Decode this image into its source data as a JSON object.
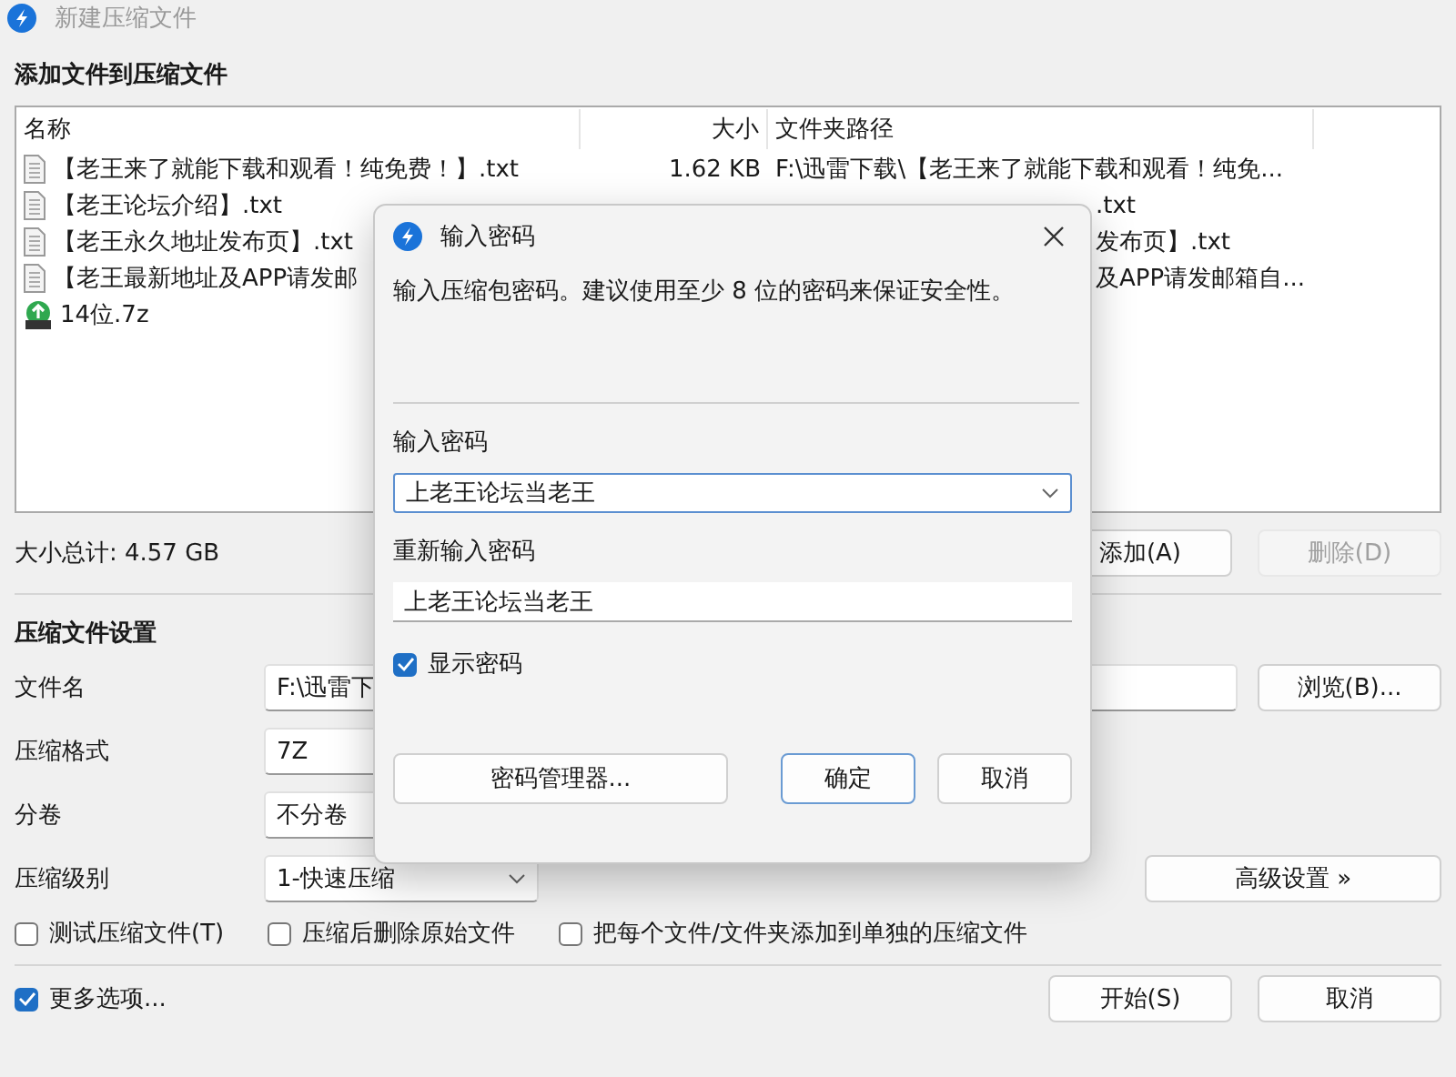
{
  "window": {
    "title": "新建压缩文件"
  },
  "files": {
    "heading": "添加文件到压缩文件",
    "columns": [
      "名称",
      "大小",
      "文件夹路径"
    ],
    "rows": [
      {
        "kind": "text",
        "name": "【老王来了就能下载和观看！纯免费！】.txt",
        "size": "1.62 KB",
        "path": "F:\\迅雷下载\\【老王来了就能下载和观看！纯免...",
        "covered": false
      },
      {
        "kind": "text",
        "name": "【老王论坛介绍】.txt",
        "path": ".txt",
        "covered": true
      },
      {
        "kind": "text",
        "name": "【老王永久地址发布页】.txt",
        "path": "发布页】.txt",
        "covered": true
      },
      {
        "kind": "text",
        "name": "【老王最新地址及APP请发邮",
        "path": "及APP请发邮箱自...",
        "covered": true
      },
      {
        "kind": "archive",
        "name": "14位.7z"
      }
    ],
    "total": "大小总计: 4.57 GB",
    "buttons": [
      {
        "label": "添加(A)",
        "disabled": false
      },
      {
        "label": "删除(D)",
        "disabled": true
      }
    ]
  },
  "settings": {
    "heading": "压缩文件设置",
    "fields": [
      {
        "label": "文件名",
        "kind": "text",
        "value": "F:\\迅雷下"
      },
      {
        "label": "压缩格式",
        "kind": "covered_select",
        "value": "7Z"
      },
      {
        "label": "分卷",
        "kind": "covered_select",
        "value": "不分卷"
      },
      {
        "label": "压缩级别",
        "kind": "select",
        "value": "1-快速压缩"
      }
    ],
    "browse_button": "浏览(B)...",
    "advanced_button": "高级设置 »",
    "options": [
      {
        "label": "测试压缩文件(T)",
        "checked": false
      },
      {
        "label": "压缩后删除原始文件",
        "checked": false
      },
      {
        "label": "把每个文件/文件夹添加到单独的压缩文件",
        "checked": false
      }
    ]
  },
  "footer": {
    "more_options": {
      "label": "更多选项...",
      "checked": true
    },
    "buttons": [
      "开始(S)",
      "取消"
    ]
  },
  "dialog": {
    "title": "输入密码",
    "description": "输入压缩包密码。建议使用至少 8 位的密码来保证安全性。",
    "password_label": "输入密码",
    "password": "上老王论坛当老王",
    "confirm_label": "重新输入密码",
    "confirm": "上老王论坛当老王",
    "show_password": {
      "label": "显示密码",
      "checked": true
    },
    "buttons": [
      {
        "label": "密码管理器...",
        "kind": "manager"
      },
      {
        "label": "确定",
        "kind": "default"
      },
      {
        "label": "取消",
        "kind": "normal"
      }
    ]
  }
}
